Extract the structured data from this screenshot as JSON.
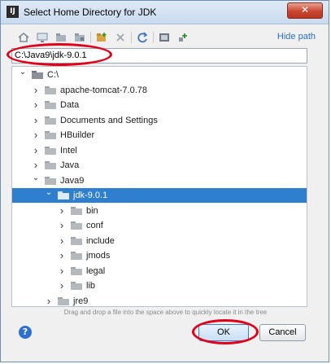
{
  "window": {
    "title": "Select Home Directory for JDK",
    "app_icon_text": "IJ",
    "close_glyph": "✕"
  },
  "toolbar": {
    "icons": [
      "home-icon",
      "desktop-icon",
      "project-icon",
      "module-icon",
      "new-folder-icon",
      "delete-icon",
      "refresh-icon",
      "show-hidden-icon",
      "expand-icon"
    ],
    "hide_path_label": "Hide path"
  },
  "path_field": {
    "value": "C:\\Java9\\jdk-9.0.1"
  },
  "tree": {
    "items": [
      {
        "label": "C:\\",
        "level": 0,
        "expanded": true,
        "kind": "drive"
      },
      {
        "label": "apache-tomcat-7.0.78",
        "level": 1,
        "expanded": false,
        "kind": "folder"
      },
      {
        "label": "Data",
        "level": 1,
        "expanded": false,
        "kind": "folder"
      },
      {
        "label": "Documents and Settings",
        "level": 1,
        "expanded": false,
        "kind": "folder"
      },
      {
        "label": "HBuilder",
        "level": 1,
        "expanded": false,
        "kind": "folder"
      },
      {
        "label": "Intel",
        "level": 1,
        "expanded": false,
        "kind": "folder"
      },
      {
        "label": "Java",
        "level": 1,
        "expanded": false,
        "kind": "folder"
      },
      {
        "label": "Java9",
        "level": 1,
        "expanded": true,
        "kind": "folder"
      },
      {
        "label": "jdk-9.0.1",
        "level": 2,
        "expanded": true,
        "kind": "folder",
        "selected": true
      },
      {
        "label": "bin",
        "level": 3,
        "expanded": false,
        "kind": "folder"
      },
      {
        "label": "conf",
        "level": 3,
        "expanded": false,
        "kind": "folder"
      },
      {
        "label": "include",
        "level": 3,
        "expanded": false,
        "kind": "folder"
      },
      {
        "label": "jmods",
        "level": 3,
        "expanded": false,
        "kind": "folder"
      },
      {
        "label": "legal",
        "level": 3,
        "expanded": false,
        "kind": "folder"
      },
      {
        "label": "lib",
        "level": 3,
        "expanded": false,
        "kind": "folder"
      },
      {
        "label": "jre9",
        "level": 2,
        "expanded": false,
        "kind": "folder"
      }
    ]
  },
  "hint": "Drag and drop a file into the space above to quickly locate it in the tree",
  "buttons": {
    "help_glyph": "?",
    "ok": "OK",
    "cancel": "Cancel"
  },
  "colors": {
    "selection": "#2f7fcf",
    "link": "#2a6fc4",
    "annotation": "#e0001a"
  }
}
